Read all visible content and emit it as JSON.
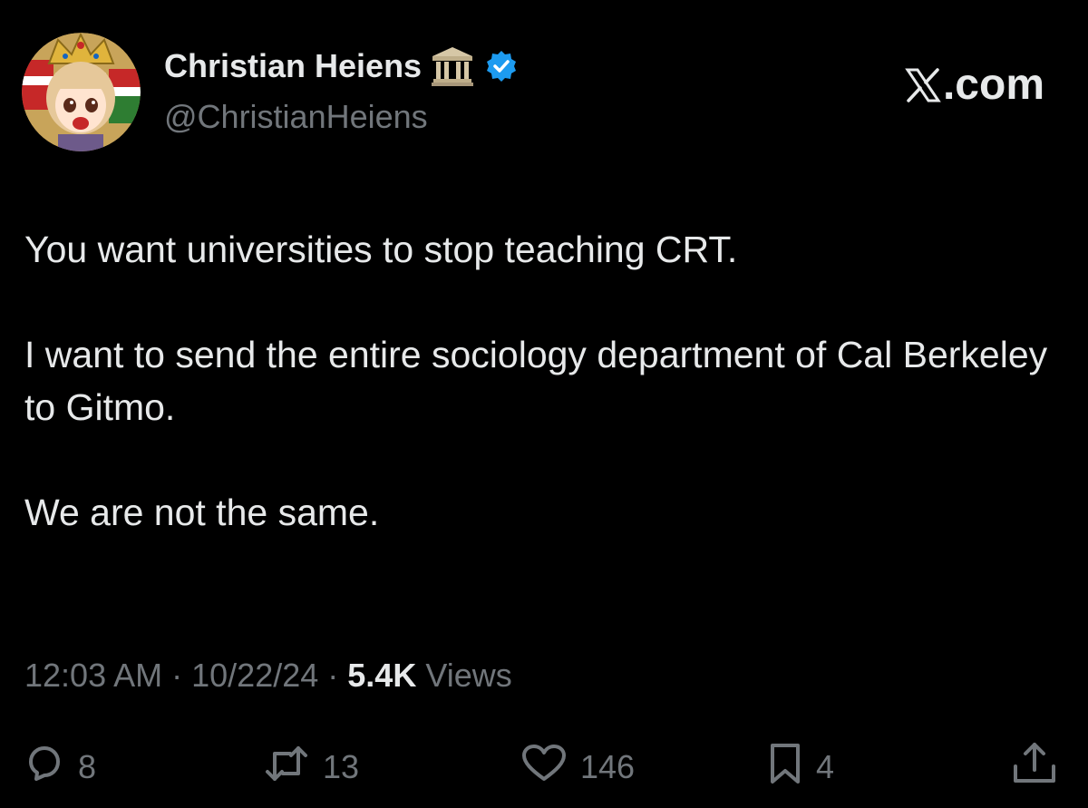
{
  "author": {
    "display_name": "Christian Heiens",
    "name_emoji": "classical-building-icon",
    "verified_icon": "verified-badge-icon",
    "handle": "@ChristianHeiens",
    "avatar": "avatar"
  },
  "brand": {
    "icon": "x-logo-icon",
    "suffix": ".com"
  },
  "tweet": {
    "paragraphs": [
      "You want universities to stop teaching CRT.",
      "I want to send the entire sociology department of Cal Berkeley to Gitmo.",
      "We are not the same."
    ]
  },
  "meta": {
    "time": "12:03 AM",
    "separator": "·",
    "date": "10/22/24",
    "views_count": "5.4K",
    "views_label": "Views"
  },
  "actions": {
    "replies": {
      "icon": "reply-icon",
      "count": "8"
    },
    "reposts": {
      "icon": "repost-icon",
      "count": "13"
    },
    "likes": {
      "icon": "heart-icon",
      "count": "146"
    },
    "bookmarks": {
      "icon": "bookmark-icon",
      "count": "4"
    },
    "share": {
      "icon": "share-icon"
    }
  },
  "colors": {
    "background": "#000000",
    "primary_text": "#e7e9ea",
    "secondary_text": "#71767b",
    "verified_blue": "#1d9bf0"
  }
}
